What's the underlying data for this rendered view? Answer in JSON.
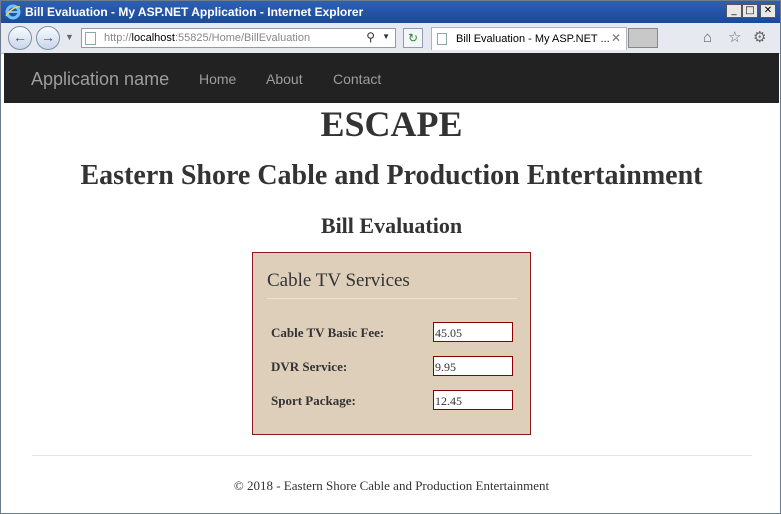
{
  "window": {
    "title": "Bill Evaluation - My ASP.NET Application - Internet Explorer",
    "controls": {
      "minimize": "_",
      "maximize": "□",
      "close": "✕"
    }
  },
  "browser": {
    "address": {
      "prefix": "http://",
      "host": "localhost",
      "rest": ":55825/Home/BillEvaluation"
    },
    "tab": {
      "label": "Bill Evaluation - My ASP.NET ...",
      "close": "✕"
    },
    "icons": [
      "back-icon",
      "forward-icon",
      "refresh-icon",
      "search-icon",
      "home-icon",
      "star-icon",
      "gear-icon"
    ]
  },
  "navbar": {
    "brand": "Application name",
    "links": [
      "Home",
      "About",
      "Contact"
    ],
    "background": "#222222"
  },
  "page": {
    "heading1": "ESCAPE",
    "heading2": "Eastern Shore Cable and Production Entertainment",
    "heading3": "Bill Evaluation"
  },
  "panel": {
    "title": "Cable TV Services",
    "background": "#decfba",
    "border_color": "#8b1a1a",
    "fields": [
      {
        "label": "Cable TV Basic Fee:",
        "value": "45.05"
      },
      {
        "label": "DVR Service:",
        "value": "9.95"
      },
      {
        "label": "Sport Package:",
        "value": "12.45"
      }
    ]
  },
  "footer": {
    "text": "© 2018 - Eastern Shore Cable and Production Entertainment"
  }
}
